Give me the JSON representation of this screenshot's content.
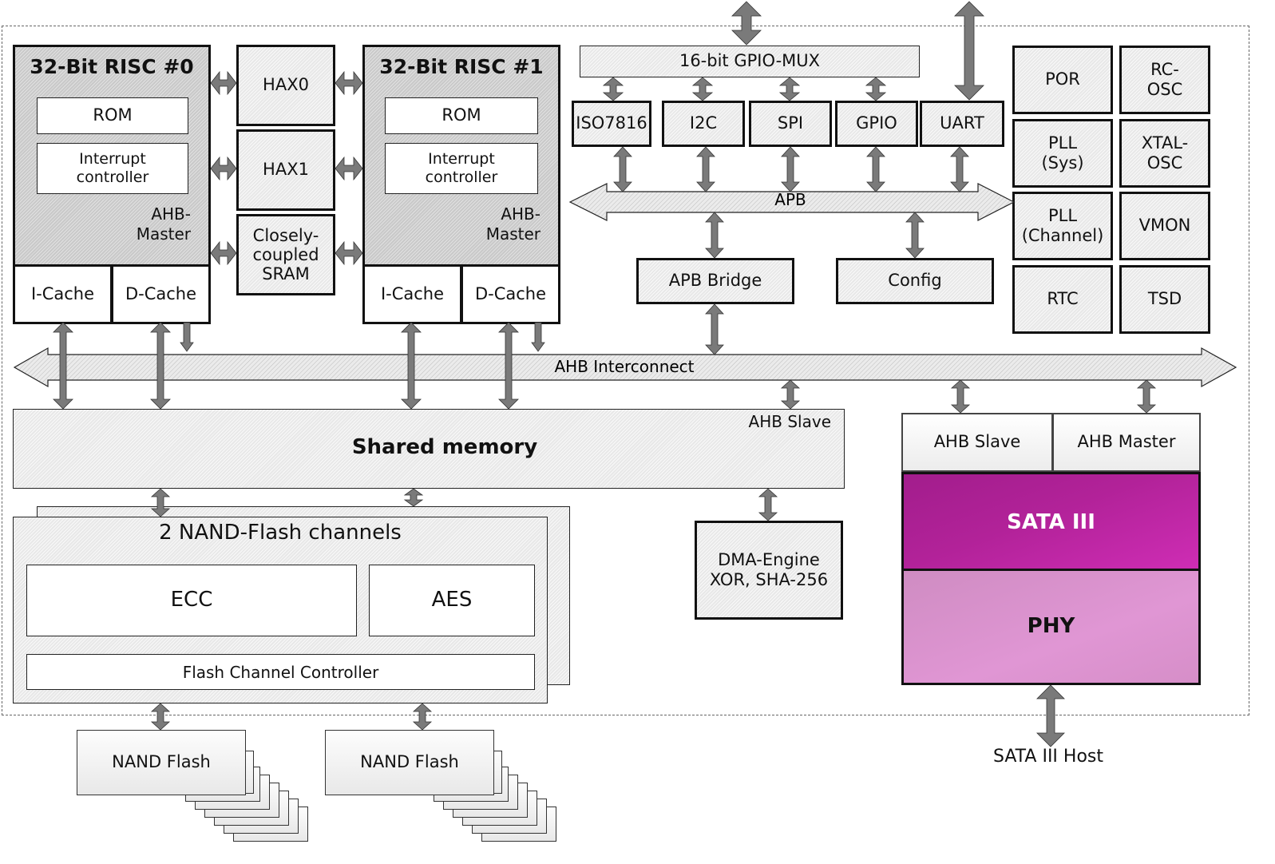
{
  "diagram": {
    "cpu0": {
      "title": "32-Bit RISC #0",
      "rom": "ROM",
      "interrupt": "Interrupt\ncontroller",
      "ahb": "AHB-\nMaster",
      "icache": "I-Cache",
      "dcache": "D-Cache"
    },
    "cpu1": {
      "title": "32-Bit RISC #1",
      "rom": "ROM",
      "interrupt": "Interrupt\ncontroller",
      "ahb": "AHB-\nMaster",
      "icache": "I-Cache",
      "dcache": "D-Cache"
    },
    "hax0": "HAX0",
    "hax1": "HAX1",
    "ccsram": "Closely-\ncoupled\nSRAM",
    "gpio_mux": "16-bit GPIO-MUX",
    "peripherals": [
      "ISO7816",
      "I2C",
      "SPI",
      "GPIO",
      "UART"
    ],
    "apb": "APB",
    "apb_bridge": "APB Bridge",
    "config": "Config",
    "system_blocks": [
      "POR",
      "RC-\nOSC",
      "PLL\n(Sys)",
      "XTAL-\nOSC",
      "PLL\n(Channel)",
      "VMON",
      "RTC",
      "TSD"
    ],
    "ahb_interconnect": "AHB Interconnect",
    "shared_memory": {
      "title": "Shared memory",
      "port": "AHB Slave"
    },
    "dma": "DMA-Engine\nXOR, SHA-256",
    "sata": {
      "ahb_slave": "AHB Slave",
      "ahb_master": "AHB Master",
      "core": "SATA III",
      "phy": "PHY",
      "host": "SATA III Host"
    },
    "nand_channels": {
      "title": "2 NAND-Flash channels",
      "ecc": "ECC",
      "aes": "AES",
      "controller": "Flash Channel Controller"
    },
    "nand_flash": [
      "NAND Flash",
      "NAND Flash"
    ],
    "colors": {
      "sata_core": "#b0209a",
      "phy": "#d890c8",
      "arrow": "#7a7a7a",
      "cpu_fill": "#c9c9c9"
    }
  }
}
